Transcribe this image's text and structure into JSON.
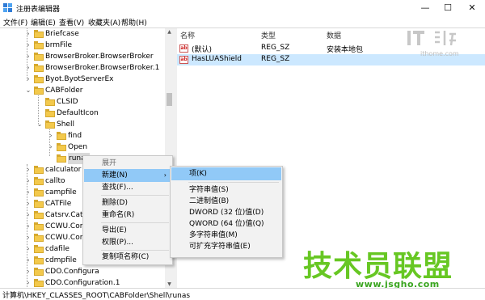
{
  "window": {
    "title": "注册表编辑器",
    "controls": {
      "minimize": "—",
      "maximize": "☐",
      "close": "✕"
    }
  },
  "menubar": [
    "文件(F)",
    "编辑(E)",
    "查看(V)",
    "收藏夹(A)",
    "帮助(H)"
  ],
  "tree": {
    "items": [
      {
        "label": "Briefcase"
      },
      {
        "label": "brmFile"
      },
      {
        "label": "BrowserBroker.BrowserBroker"
      },
      {
        "label": "BrowserBroker.BrowserBroker.1"
      },
      {
        "label": "Byot.ByotServerEx"
      },
      {
        "label": "CABFolder"
      },
      {
        "label": "CLSID"
      },
      {
        "label": "DefaultIcon"
      },
      {
        "label": "Shell"
      },
      {
        "label": "find"
      },
      {
        "label": "Open"
      },
      {
        "label": "runas"
      },
      {
        "label": "calculator"
      },
      {
        "label": "callto"
      },
      {
        "label": "campfile"
      },
      {
        "label": "CATFile"
      },
      {
        "label": "Catsrv.Catalo"
      },
      {
        "label": "CCWU.ComO"
      },
      {
        "label": "CCWU.ComO"
      },
      {
        "label": "cdafile"
      },
      {
        "label": "cdmpfile"
      },
      {
        "label": "CDO.Configura"
      },
      {
        "label": "CDO.Configuration.1"
      }
    ],
    "expander_collapsed": "›",
    "expander_expanded": "⌄"
  },
  "list": {
    "headers": [
      "名称",
      "类型",
      "数据"
    ],
    "rows": [
      {
        "name": "(默认)",
        "type": "REG_SZ",
        "data": "安装本地包"
      },
      {
        "name": "HasLUAShield",
        "type": "REG_SZ",
        "data": ""
      }
    ]
  },
  "context_menu": {
    "items": [
      "展开",
      "新建(N)",
      "查找(F)...",
      "删除(D)",
      "重命名(R)",
      "导出(E)",
      "权限(P)...",
      "复制项名称(C)"
    ],
    "submenu_arrow": "›"
  },
  "submenu": {
    "items": [
      "项(K)",
      "字符串值(S)",
      "二进制值(B)",
      "DWORD (32 位)值(D)",
      "QWORD (64 位)值(Q)",
      "多字符串值(M)",
      "可扩充字符串值(E)"
    ]
  },
  "statusbar": {
    "path": "计算机\\HKEY_CLASSES_ROOT\\CABFolder\\Shell\\runas"
  },
  "watermarks": {
    "site": "ithome.com",
    "cn_brand": "技术员联盟",
    "url": "www.jsgho.com"
  },
  "colors": {
    "selection": "#cce8ff",
    "menu_highlight": "#91c9f7",
    "folder": "#f3c94c",
    "watermark_green": "#67c723"
  }
}
